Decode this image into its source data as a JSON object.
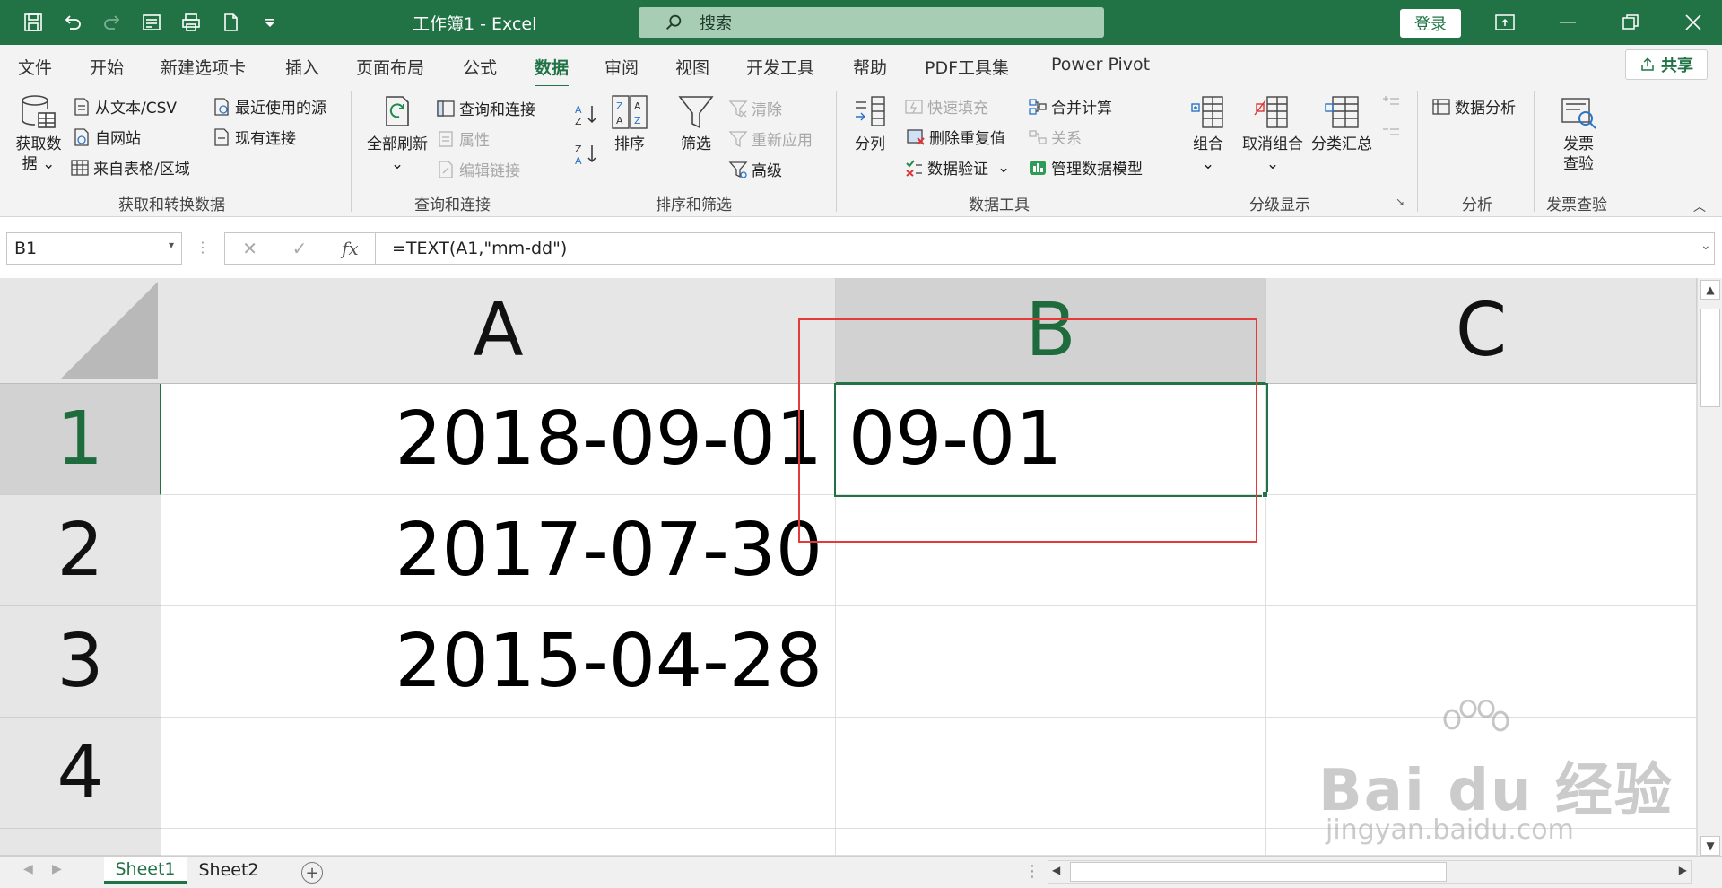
{
  "titlebar": {
    "title": "工作簿1  -  Excel",
    "search_placeholder": "搜索",
    "login_label": "登录",
    "bg_color": "#217346"
  },
  "menu": {
    "tabs": [
      "文件",
      "开始",
      "新建选项卡",
      "插入",
      "页面布局",
      "公式",
      "数据",
      "审阅",
      "视图",
      "开发工具",
      "帮助",
      "PDF工具集",
      "Power Pivot"
    ],
    "active_tab": "数据",
    "share_label": "共享"
  },
  "ribbon": {
    "get_data": {
      "big_label_line1": "获取数",
      "big_label_line2": "据 ⌄",
      "from_text": "从文本/CSV",
      "from_web": "自网站",
      "from_table": "来自表格/区域",
      "recent_sources": "最近使用的源",
      "existing_connections": "现有连接",
      "group_label": "获取和转换数据"
    },
    "queries": {
      "refresh_all_line1": "全部刷新",
      "refresh_all_line2": "⌄",
      "queries_connections": "查询和连接",
      "properties": "属性",
      "edit_links": "编辑链接",
      "group_label": "查询和连接"
    },
    "sort_filter": {
      "sort": "排序",
      "filter": "筛选",
      "clear": "清除",
      "reapply": "重新应用",
      "advanced": "高级",
      "group_label": "排序和筛选"
    },
    "data_tools": {
      "text_to_columns": "分列",
      "flash_fill": "快速填充",
      "remove_duplicates": "删除重复值",
      "data_validation": "数据验证",
      "consolidate": "合并计算",
      "relationships": "关系",
      "manage_model": "管理数据模型",
      "group_label": "数据工具"
    },
    "outline": {
      "group": "组合",
      "ungroup": "取消组合",
      "subtotal": "分类汇总",
      "group_label": "分级显示"
    },
    "analysis": {
      "data_analysis": "数据分析",
      "group_label": "分析"
    },
    "invoice": {
      "label_line1": "发票",
      "label_line2": "查验",
      "group_label": "发票查验"
    }
  },
  "formula_bar": {
    "name_box": "B1",
    "formula": "=TEXT(A1,\"mm-dd\")"
  },
  "sheet": {
    "columns": [
      "A",
      "B",
      "C"
    ],
    "rows": [
      "1",
      "2",
      "3",
      "4"
    ],
    "cells": {
      "A1": "2018-09-01",
      "A2": "2017-07-30",
      "A3": "2015-04-28",
      "B1": "09-01"
    },
    "selected_cell": "B1",
    "highlight_color": "#e63a3a"
  },
  "sheet_tabs": [
    "Sheet1",
    "Sheet2"
  ],
  "active_sheet": "Sheet1",
  "watermark": {
    "brand": "Bai du 经验",
    "url": "jingyan.baidu.com"
  }
}
